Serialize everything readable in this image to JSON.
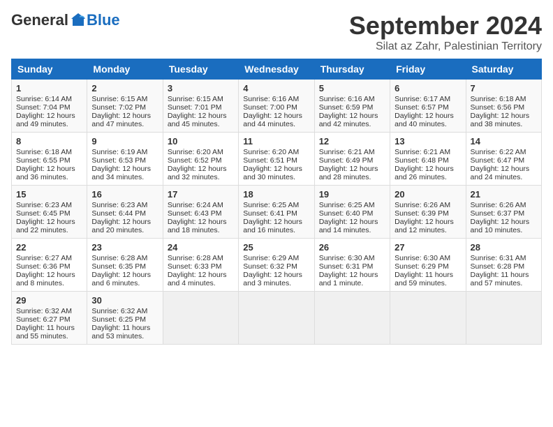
{
  "logo": {
    "general": "General",
    "blue": "Blue"
  },
  "header": {
    "title": "September 2024",
    "subtitle": "Silat az Zahr, Palestinian Territory"
  },
  "days": [
    "Sunday",
    "Monday",
    "Tuesday",
    "Wednesday",
    "Thursday",
    "Friday",
    "Saturday"
  ],
  "weeks": [
    [
      {
        "day": 1,
        "sunrise": "6:14 AM",
        "sunset": "7:04 PM",
        "daylight": "12 hours and 49 minutes."
      },
      {
        "day": 2,
        "sunrise": "6:15 AM",
        "sunset": "7:02 PM",
        "daylight": "12 hours and 47 minutes."
      },
      {
        "day": 3,
        "sunrise": "6:15 AM",
        "sunset": "7:01 PM",
        "daylight": "12 hours and 45 minutes."
      },
      {
        "day": 4,
        "sunrise": "6:16 AM",
        "sunset": "7:00 PM",
        "daylight": "12 hours and 44 minutes."
      },
      {
        "day": 5,
        "sunrise": "6:16 AM",
        "sunset": "6:59 PM",
        "daylight": "12 hours and 42 minutes."
      },
      {
        "day": 6,
        "sunrise": "6:17 AM",
        "sunset": "6:57 PM",
        "daylight": "12 hours and 40 minutes."
      },
      {
        "day": 7,
        "sunrise": "6:18 AM",
        "sunset": "6:56 PM",
        "daylight": "12 hours and 38 minutes."
      }
    ],
    [
      {
        "day": 8,
        "sunrise": "6:18 AM",
        "sunset": "6:55 PM",
        "daylight": "12 hours and 36 minutes."
      },
      {
        "day": 9,
        "sunrise": "6:19 AM",
        "sunset": "6:53 PM",
        "daylight": "12 hours and 34 minutes."
      },
      {
        "day": 10,
        "sunrise": "6:20 AM",
        "sunset": "6:52 PM",
        "daylight": "12 hours and 32 minutes."
      },
      {
        "day": 11,
        "sunrise": "6:20 AM",
        "sunset": "6:51 PM",
        "daylight": "12 hours and 30 minutes."
      },
      {
        "day": 12,
        "sunrise": "6:21 AM",
        "sunset": "6:49 PM",
        "daylight": "12 hours and 28 minutes."
      },
      {
        "day": 13,
        "sunrise": "6:21 AM",
        "sunset": "6:48 PM",
        "daylight": "12 hours and 26 minutes."
      },
      {
        "day": 14,
        "sunrise": "6:22 AM",
        "sunset": "6:47 PM",
        "daylight": "12 hours and 24 minutes."
      }
    ],
    [
      {
        "day": 15,
        "sunrise": "6:23 AM",
        "sunset": "6:45 PM",
        "daylight": "12 hours and 22 minutes."
      },
      {
        "day": 16,
        "sunrise": "6:23 AM",
        "sunset": "6:44 PM",
        "daylight": "12 hours and 20 minutes."
      },
      {
        "day": 17,
        "sunrise": "6:24 AM",
        "sunset": "6:43 PM",
        "daylight": "12 hours and 18 minutes."
      },
      {
        "day": 18,
        "sunrise": "6:25 AM",
        "sunset": "6:41 PM",
        "daylight": "12 hours and 16 minutes."
      },
      {
        "day": 19,
        "sunrise": "6:25 AM",
        "sunset": "6:40 PM",
        "daylight": "12 hours and 14 minutes."
      },
      {
        "day": 20,
        "sunrise": "6:26 AM",
        "sunset": "6:39 PM",
        "daylight": "12 hours and 12 minutes."
      },
      {
        "day": 21,
        "sunrise": "6:26 AM",
        "sunset": "6:37 PM",
        "daylight": "12 hours and 10 minutes."
      }
    ],
    [
      {
        "day": 22,
        "sunrise": "6:27 AM",
        "sunset": "6:36 PM",
        "daylight": "12 hours and 8 minutes."
      },
      {
        "day": 23,
        "sunrise": "6:28 AM",
        "sunset": "6:35 PM",
        "daylight": "12 hours and 6 minutes."
      },
      {
        "day": 24,
        "sunrise": "6:28 AM",
        "sunset": "6:33 PM",
        "daylight": "12 hours and 4 minutes."
      },
      {
        "day": 25,
        "sunrise": "6:29 AM",
        "sunset": "6:32 PM",
        "daylight": "12 hours and 3 minutes."
      },
      {
        "day": 26,
        "sunrise": "6:30 AM",
        "sunset": "6:31 PM",
        "daylight": "12 hours and 1 minute."
      },
      {
        "day": 27,
        "sunrise": "6:30 AM",
        "sunset": "6:29 PM",
        "daylight": "11 hours and 59 minutes."
      },
      {
        "day": 28,
        "sunrise": "6:31 AM",
        "sunset": "6:28 PM",
        "daylight": "11 hours and 57 minutes."
      }
    ],
    [
      {
        "day": 29,
        "sunrise": "6:32 AM",
        "sunset": "6:27 PM",
        "daylight": "11 hours and 55 minutes."
      },
      {
        "day": 30,
        "sunrise": "6:32 AM",
        "sunset": "6:25 PM",
        "daylight": "11 hours and 53 minutes."
      },
      null,
      null,
      null,
      null,
      null
    ]
  ]
}
